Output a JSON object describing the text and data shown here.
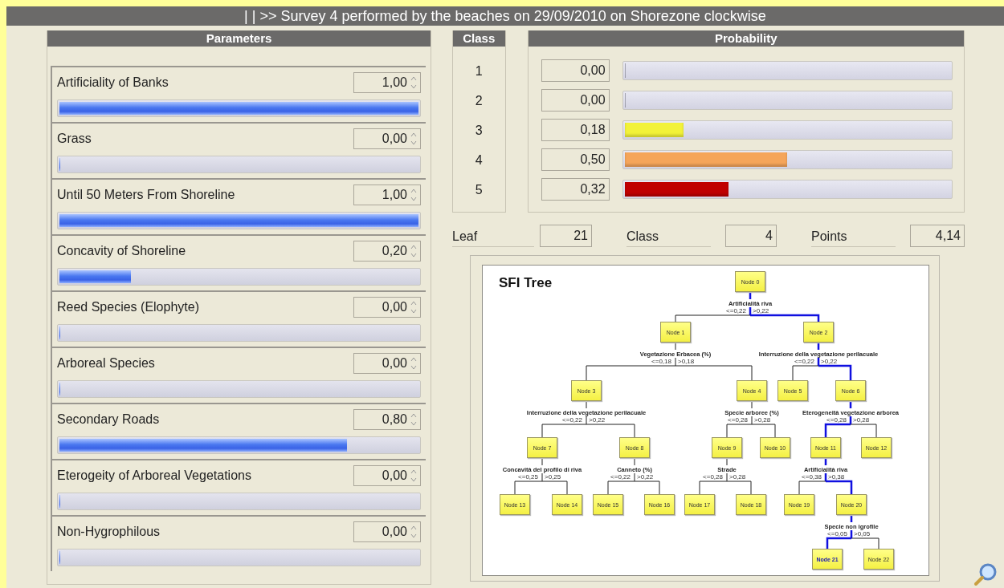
{
  "title": "| | >> Survey 4 performed by the beaches on 29/09/2010 on Shorezone clockwise",
  "parameters": {
    "header": "Parameters",
    "items": [
      {
        "name": "Artificiality of Banks",
        "value": "1,00",
        "level": 1
      },
      {
        "name": "Grass",
        "value": "0,00",
        "level": 0
      },
      {
        "name": "Until 50 Meters From Shoreline",
        "value": "1,00",
        "level": 1
      },
      {
        "name": "Concavity of Shoreline",
        "value": "0,20",
        "level": 0.2
      },
      {
        "name": "Reed Species (Elophyte)",
        "value": "0,00",
        "level": 0
      },
      {
        "name": "Arboreal Species",
        "value": "0,00",
        "level": 0
      },
      {
        "name": "Secondary Roads",
        "value": "0,80",
        "level": 0.8
      },
      {
        "name": "Eterogeity of Arboreal Vegetations",
        "value": "0,00",
        "level": 0
      },
      {
        "name": "Non-Hygrophilous",
        "value": "0,00",
        "level": 0
      }
    ]
  },
  "classes": {
    "header": "Class",
    "items": [
      "1",
      "2",
      "3",
      "4",
      "5"
    ]
  },
  "probability": {
    "header": "Probability",
    "items": [
      {
        "value": "0,00",
        "level": 0
      },
      {
        "value": "0,00",
        "level": 0
      },
      {
        "value": "0,18",
        "level": 0.18,
        "color": "#f2f23a"
      },
      {
        "value": "0,50",
        "level": 0.5,
        "color": "#f5a55a"
      },
      {
        "value": "0,32",
        "level": 0.32,
        "color": "#c00000"
      }
    ]
  },
  "summary": [
    {
      "label": "Leaf",
      "value": "21"
    },
    {
      "label": "Class",
      "value": "4"
    },
    {
      "label": "Points",
      "value": "4,14"
    }
  ],
  "tree": {
    "title": "SFI Tree",
    "root": {
      "label": "Node 0",
      "on_path": true,
      "split": "Artificialità riva",
      "children": [
        {
          "edge": "<=0,22",
          "label": "Node 1",
          "on_path": false,
          "split": "Vegetazione Erbacea (%)",
          "children": [
            {
              "edge": "<=0,18",
              "label": "Node 3",
              "on_path": false,
              "split": "Interruzione della vegetazione perilacuale",
              "children": [
                {
                  "edge": "<=0,22",
                  "label": "Node 7",
                  "on_path": false,
                  "split": "Concavità del profilo di riva",
                  "children": [
                    {
                      "edge": "<=0,25",
                      "label": "Node 13",
                      "on_path": false
                    },
                    {
                      "edge": ">0,25",
                      "label": "Node 14",
                      "on_path": false
                    }
                  ]
                },
                {
                  "edge": ">0,22",
                  "label": "Node 8",
                  "on_path": false,
                  "split": "Canneto (%)",
                  "children": [
                    {
                      "edge": "<=0,22",
                      "label": "Node 15",
                      "on_path": false
                    },
                    {
                      "edge": ">0,22",
                      "label": "Node 16",
                      "on_path": false
                    }
                  ]
                }
              ]
            },
            {
              "edge": ">0,18",
              "label": "Node 4",
              "on_path": false,
              "split": "Specie arboree (%)",
              "children": [
                {
                  "edge": "<=0,28",
                  "label": "Node 9",
                  "on_path": false,
                  "split": "Strade",
                  "children": [
                    {
                      "edge": "<=0,28",
                      "label": "Node 17",
                      "on_path": false
                    },
                    {
                      "edge": ">0,28",
                      "label": "Node 18",
                      "on_path": false
                    }
                  ]
                },
                {
                  "edge": ">0,28",
                  "label": "Node 10",
                  "on_path": false
                }
              ]
            }
          ]
        },
        {
          "edge": ">0,22",
          "label": "Node 2",
          "on_path": true,
          "split": "Interruzione della vegetazione perilacuale",
          "children": [
            {
              "edge": "<=0,22",
              "label": "Node 5",
              "on_path": false
            },
            {
              "edge": ">0,22",
              "label": "Node 6",
              "on_path": true,
              "split": "Eterogeneità vegetazione arborea",
              "children": [
                {
                  "edge": "<=0,28",
                  "label": "Node 11",
                  "on_path": true,
                  "split": "Artificialità riva",
                  "children": [
                    {
                      "edge": "<=0,38",
                      "label": "Node 19",
                      "on_path": false
                    },
                    {
                      "edge": ">0,38",
                      "label": "Node 20",
                      "on_path": true,
                      "split": "Specie non igrofile",
                      "children": [
                        {
                          "edge": "<=0,05",
                          "label": "Node 21",
                          "on_path": true
                        },
                        {
                          "edge": ">0,05",
                          "label": "Node 22",
                          "on_path": false
                        }
                      ]
                    }
                  ]
                },
                {
                  "edge": ">0,28",
                  "label": "Node 12",
                  "on_path": false
                }
              ]
            }
          ]
        }
      ]
    }
  }
}
